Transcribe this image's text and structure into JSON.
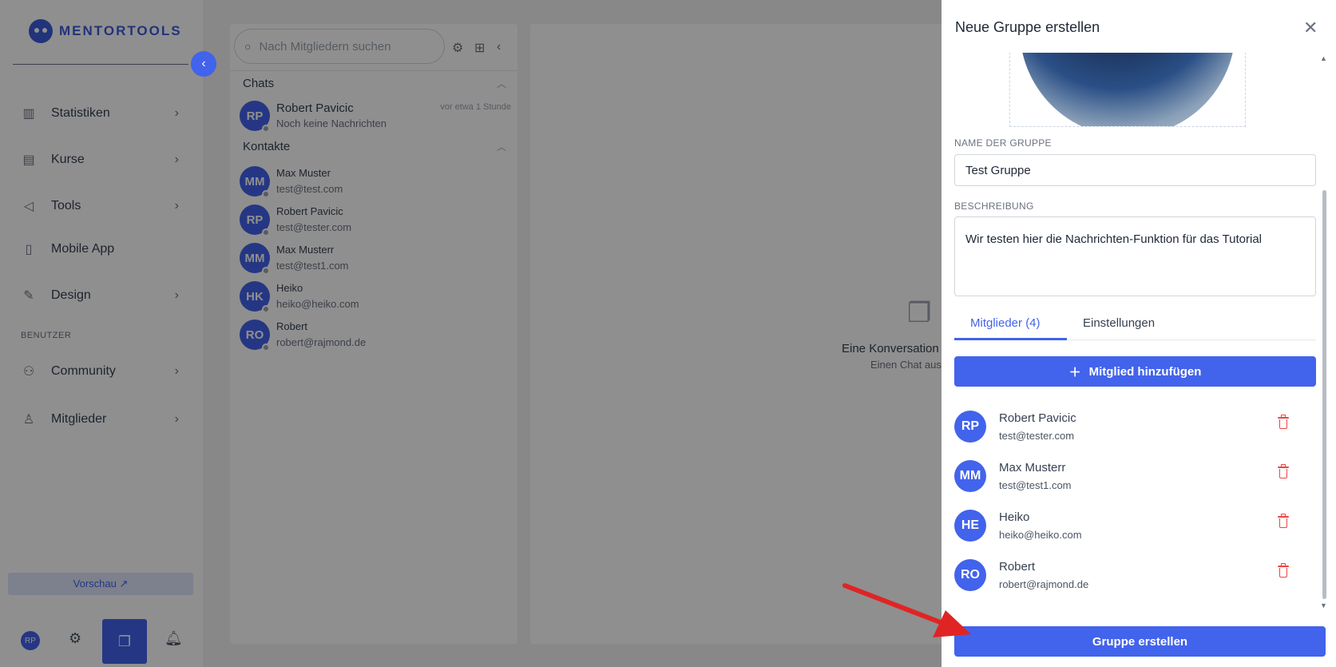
{
  "app": {
    "logo_text": "MENTORTOOLS"
  },
  "sidebar": {
    "items": [
      {
        "label": "Statistiken",
        "icon": "bar-chart-icon"
      },
      {
        "label": "Kurse",
        "icon": "book-icon"
      },
      {
        "label": "Tools",
        "icon": "megaphone-icon"
      },
      {
        "label": "Mobile App",
        "icon": "mobile-icon"
      },
      {
        "label": "Design",
        "icon": "edit-icon"
      },
      {
        "label": "Community",
        "icon": "community-icon"
      },
      {
        "label": "Mitglieder",
        "icon": "user-icon"
      }
    ],
    "section_label": "BENUTZER",
    "preview_label": "Vorschau ↗",
    "user_initials": "RP"
  },
  "chat_list": {
    "search_placeholder": "Nach Mitgliedern suchen",
    "chats_heading": "Chats",
    "contacts_heading": "Kontakte",
    "chats": [
      {
        "initials": "RP",
        "name": "Robert Pavicic",
        "subtitle": "Noch keine Nachrichten",
        "time": "vor etwa 1 Stunde"
      }
    ],
    "contacts": [
      {
        "initials": "MM",
        "name": "Max Muster",
        "email": "test@test.com"
      },
      {
        "initials": "RP",
        "name": "Robert Pavicic",
        "email": "test@tester.com"
      },
      {
        "initials": "MM",
        "name": "Max Musterr",
        "email": "test@test1.com"
      },
      {
        "initials": "HK",
        "name": "Heiko",
        "email": "heiko@heiko.com"
      },
      {
        "initials": "RO",
        "name": "Robert",
        "email": "robert@rajmond.de"
      }
    ]
  },
  "conversation": {
    "empty_title": "Eine Konversation",
    "empty_subtitle": "Einen Chat aus"
  },
  "drawer": {
    "title": "Neue Gruppe erstellen",
    "name_label": "NAME DER GRUPPE",
    "name_value": "Test Gruppe",
    "description_label": "BESCHREIBUNG",
    "description_value": "Wir testen hier die Nachrichten-Funktion für das Tutorial",
    "tabs": [
      {
        "label": "Mitglieder (4)"
      },
      {
        "label": "Einstellungen"
      }
    ],
    "add_member_label": "Mitglied hinzufügen",
    "members": [
      {
        "initials": "RP",
        "name": "Robert Pavicic",
        "email": "test@tester.com"
      },
      {
        "initials": "MM",
        "name": "Max Musterr",
        "email": "test@test1.com"
      },
      {
        "initials": "HE",
        "name": "Heiko",
        "email": "heiko@heiko.com"
      },
      {
        "initials": "RO",
        "name": "Robert",
        "email": "robert@rajmond.de"
      }
    ],
    "create_label": "Gruppe erstellen"
  },
  "colors": {
    "accent": "#4263eb",
    "danger": "#ef4444",
    "annotation": "#e02424"
  }
}
